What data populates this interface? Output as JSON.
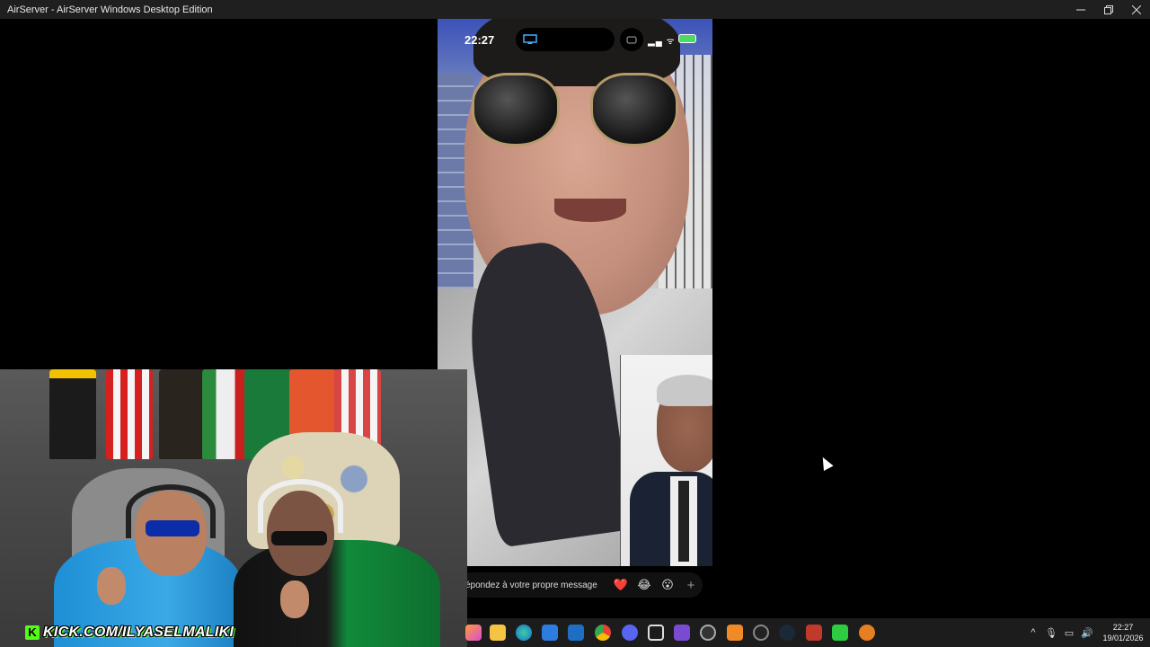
{
  "window": {
    "title": "AirServer - AirServer Windows Desktop Edition",
    "minimize_icon": "minimize-icon",
    "restore_icon": "restore-icon",
    "close_icon": "close-icon"
  },
  "phone": {
    "time": "22:27",
    "signal_icon": "signal-icon",
    "wifi_icon": "wifi-icon",
    "battery_icon": "battery-icon"
  },
  "reply": {
    "placeholder": "épondez à votre propre message",
    "reactions": [
      "❤️",
      "😂",
      "😮"
    ],
    "plus": "+"
  },
  "overlay": {
    "kick_logo": "K",
    "stream_url": "KICK.COM/ILYASELMALIKI"
  },
  "taskbar": {
    "icons": [
      "app-icon",
      "file-explorer-icon",
      "edge-icon",
      "store-icon",
      "outlook-icon",
      "chrome-icon",
      "discord-icon",
      "airserver-icon",
      "game-controller-icon",
      "app-icon",
      "app-icon",
      "app-icon",
      "steam-icon",
      "app-icon",
      "media-player-icon",
      "app-icon"
    ],
    "tray": {
      "chevron": "^",
      "clock_time": "22:27",
      "clock_date": "19/01/2026"
    }
  }
}
